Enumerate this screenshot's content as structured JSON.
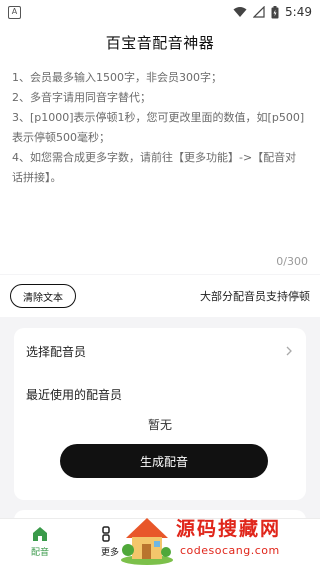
{
  "status_bar": {
    "time": "5:49",
    "icons": [
      "app-notification-icon",
      "wifi-icon",
      "signal-icon",
      "battery-icon"
    ]
  },
  "header": {
    "title": "百宝音配音神器"
  },
  "editor": {
    "instructions": [
      "1、会员最多输入1500字，非会员300字；",
      "2、多音字请用同音字替代；",
      "3、[p1000]表示停顿1秒，您可更改里面的数值，如[p500]",
      "表示停顿500毫秒；",
      "4、如您需合成更多字数，请前往【更多功能】->【配音对",
      "话拼接】。"
    ],
    "char_count": "0/300"
  },
  "actions": {
    "clear_label": "清除文本",
    "pause_hint": "大部分配音员支持停顿"
  },
  "voice_card": {
    "select_label": "选择配音员",
    "recent_label": "最近使用的配音员",
    "recent_empty": "暂无",
    "generate_label": "生成配音"
  },
  "bottom_nav": {
    "items": [
      {
        "label": "配音",
        "icon": "home-icon",
        "active": true
      },
      {
        "label": "更多",
        "icon": "grid-icon",
        "active": false
      }
    ]
  },
  "watermark": {
    "logo_text": "源码搜藏网",
    "url": "codesocang.com"
  },
  "colors": {
    "accent_green": "#3a9a4a",
    "button_dark": "#111111",
    "watermark_red": "#e0261b",
    "page_bg": "#f4f4f6"
  }
}
